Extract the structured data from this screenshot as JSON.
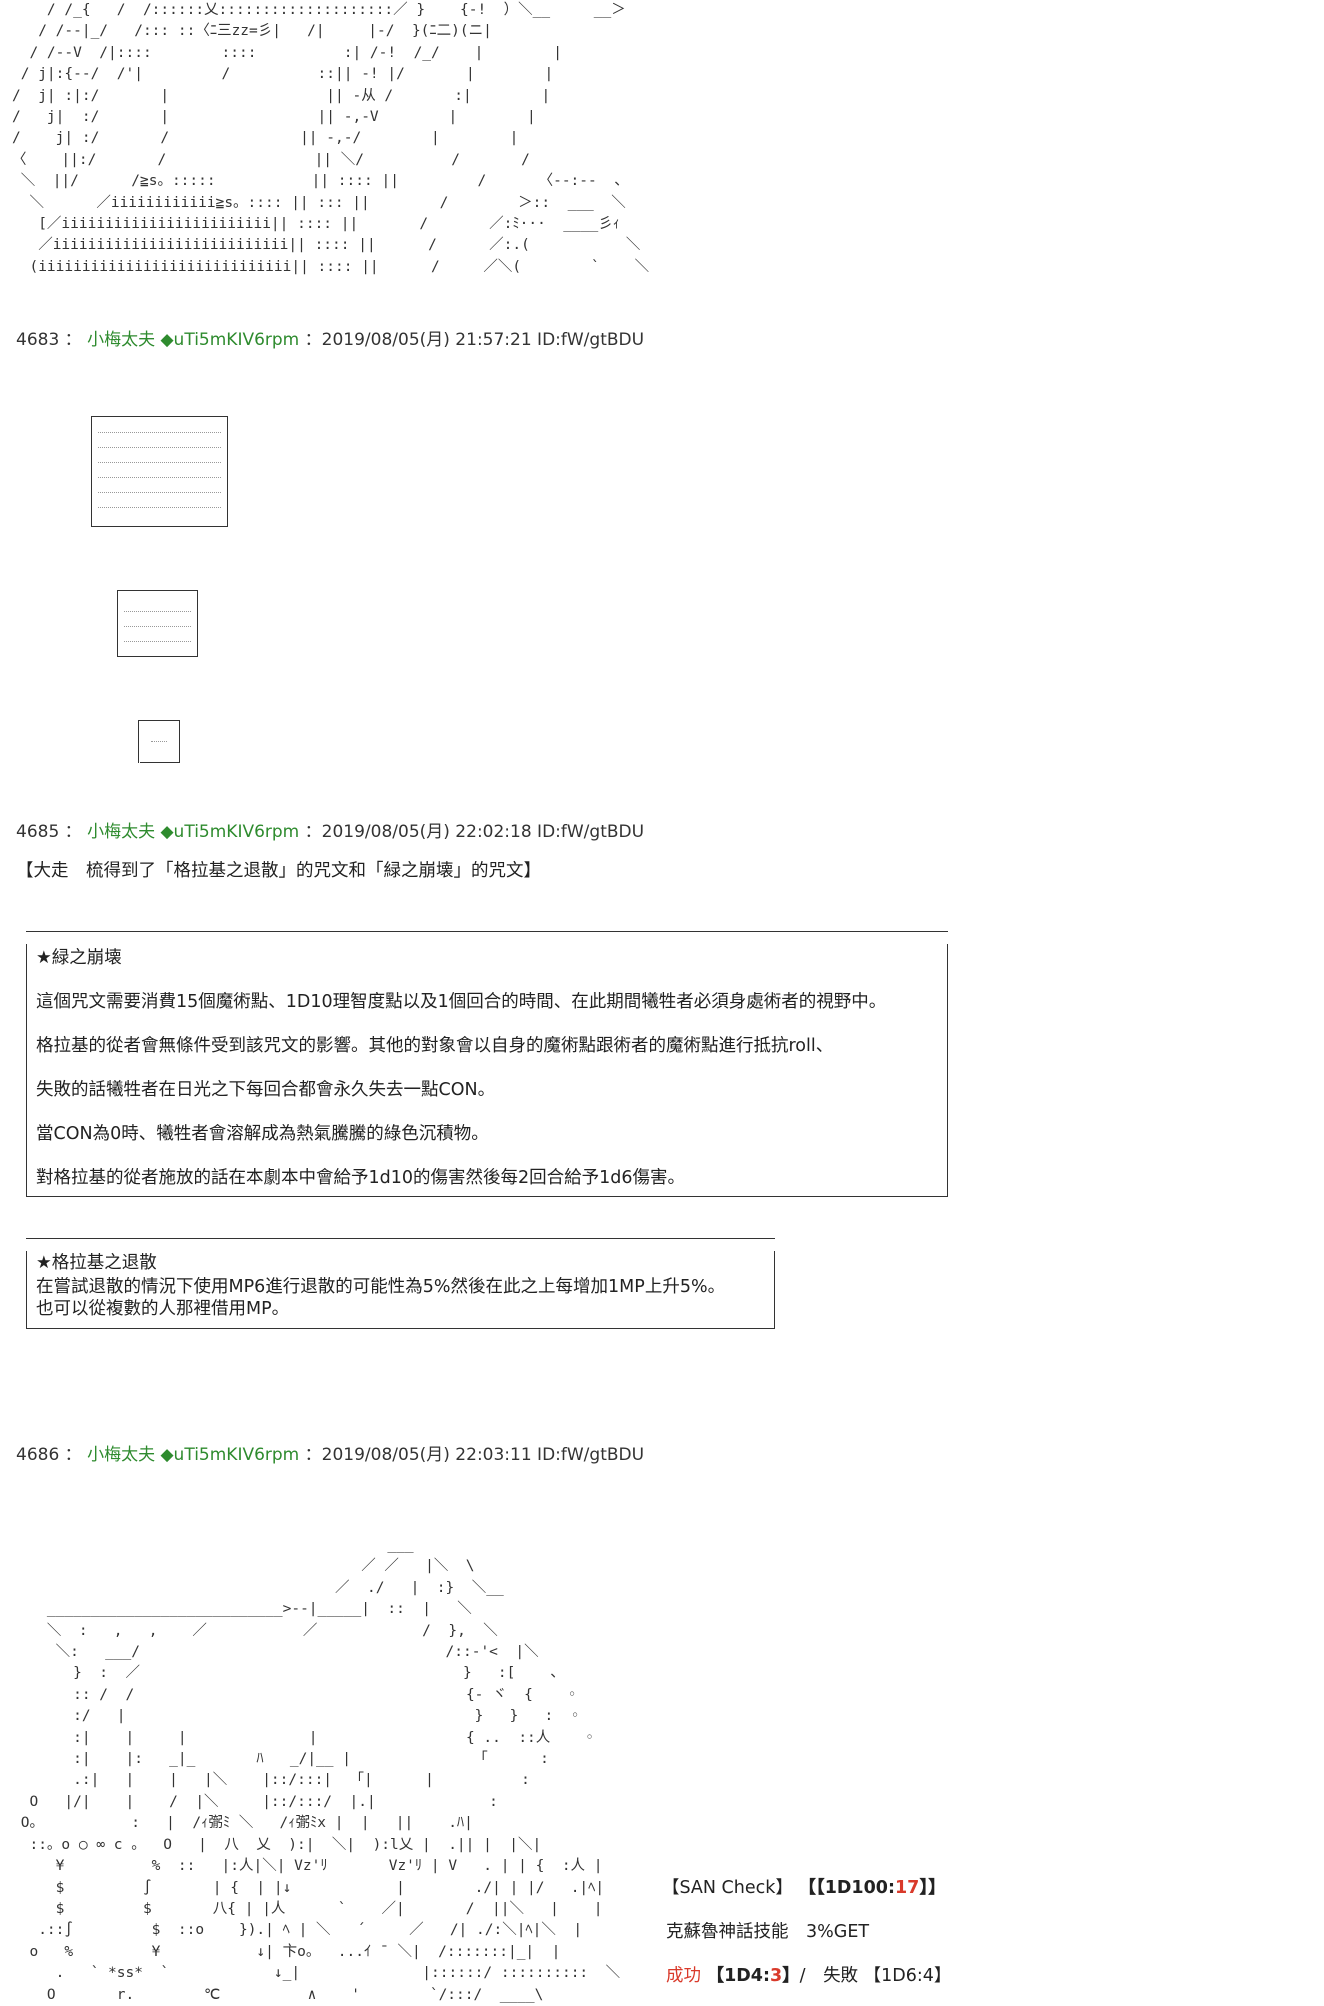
{
  "art": {
    "top": "    / /_{   /  /::::::乂::::::::::::::::::::／ }    {-!  ）＼__     __＞\n   / /--|_/   /::: ::〈ﾆ三zz=彡|   /|     |-/  }(ﾆ二)(ニ|\n  / /--V  /|::::        ::::          :| /-!  /_/    |        |\n / j|:{--/  /'|         /          ::|| -! |/       |        |\n/  j| :|:/       |                  || -从 /       :|        |\n/   j|  :/       |                 || -,-V        |        |\n/    j| :/       /               || -,-/        |        |\n〈    ||:/       /                 || ＼/          /       /\n ＼  ||/      /≧s。:::::           || :::: ||         /      〈--:--  、\n  ＼      ／iiiiiiiiiiii≧s。:::: || ::: ||        /        ＞::  ___  ＼\n   [／iiiiiiiiiiiiiiiiiiiiiiii|| :::: ||       /       ／:ﾐ···  ____彡ｨ\n   ／iiiiiiiiiiiiiiiiiiiiiiiiiii|| :::: ||      /      ／:.(           ＼\n  (iiiiiiiiiiiiiiiiiiiiiiiiiiiii|| :::: ||      /     ／＼(        `    ＼",
    "bottom": "                                           ___              \n                                        ／ ／   |＼  \\\n                                     ／  ./   |  :}  ＼__\n    ___________________________>--|_____|  ::  |   ＼\n    ＼  :   ,   ,    ／           ／            /  },  ＼\n     ＼:   ___/                                   /::-'<  |＼\n       }  :  ／                                     }   :[    、\n       :: /  /                                      {- ヾ  {    ◦\n       :/   |                                        }   }   :  ◦\n       :|    |     |              |                 { ..  ::人    ◦\n       :|    |:   _|_       ﾊ   _/|__ |              「      :\n       .:|   |    |   |＼    |::/:::|  「|      |          :\n  O   |/|    |    /  |＼     |::/:::/  |.|             :\n O。          :   |  /ｨ㣃ﾐ ＼   /ｨ㣃ﾐx |  |   ||    .ﾊ|\n  ::。o ○ ∞ c 。  O   |  八  乂  ):|  ＼|  ):l乂 |  .|| |  |＼|\n     ¥          %  ::   |:人|＼| Vz'ﾘ       Vz'ﾘ | V   . | | {  :人 |\n     $         ∫       | {  | |↓            |        ./| | |/   .|ﾍ|\n     $         $       八{ | |人      `    ／|       /  ||＼   |    |\n   .::∫         $  ::o    }).| ﾍ | ＼   ´     ／   /| ./:＼|ﾍ|＼  |\n  o   %         ¥           ↓| 卞o。  ...ｲ ¯ ＼|  /:::::::|_|  |\n     .   ` *ss*  `            ↓_|              |::::::/ ::::::::::  ＼\n    O       r.        ℃          ∧    '        `/:::/  ____\\"
  },
  "posts": [
    {
      "number": "4683",
      "name": "小梅太夫",
      "trip": "◆uTi5mKIV6rpm",
      "date": "：2019/08/05(月) 21:57:21 ID:fW/gtBDU"
    },
    {
      "number": "4685",
      "name": "小梅太夫",
      "trip": "◆uTi5mKIV6rpm",
      "date": "：2019/08/05(月) 22:02:18 ID:fW/gtBDU"
    },
    {
      "number": "4686",
      "name": "小梅太夫",
      "trip": "◆uTi5mKIV6rpm",
      "date": "：2019/08/05(月) 22:03:11 ID:fW/gtBDU"
    }
  ],
  "header_sep": " : ",
  "intro": "【大走　梳得到了「格拉基之退散」的咒文和「緑之崩壊」的咒文】",
  "green_collapse": {
    "title": "★緑之崩壊",
    "lines": [
      "這個咒文需要消費15個魔術點、1D10理智度點以及1個回合的時間、在此期間犧牲者必須身處術者的視野中。",
      "格拉基的從者會無條件受到該咒文的影響。其他的對象會以自身的魔術點跟術者的魔術點進行抵抗roll、",
      "失敗的話犧牲者在日光之下每回合都會永久失去一點CON。",
      "當CON為0時、犧牲者會溶解成為熱氣騰騰的綠色沉積物。",
      "對格拉基的從者施放的話在本劇本中會給予1d10的傷害然後每2回合給予1d6傷害。"
    ]
  },
  "glaaki_dismiss": {
    "title": "★格拉基之退散",
    "lines": [
      "在嘗試退散的情況下使用MP6進行退散的可能性為5%然後在此之上每增加1MP上升5%。",
      "也可以從複數的人那裡借用MP。"
    ]
  },
  "san_check": {
    "label": "【SAN Check】",
    "roll_open": "【【1D100:",
    "roll_value": "17",
    "roll_close": "】】",
    "skill": "克蘇魯神話技能　3%GET",
    "success_label": "成功",
    "success_roll_open": "【1D4:",
    "success_roll_value": "3",
    "success_roll_close": "】",
    "slash": "/　",
    "fail_label": "失敗",
    "fail_roll": "【1D6:4】"
  },
  "colors": {
    "name": "#2e8b2e",
    "success": "#d93a2b"
  }
}
